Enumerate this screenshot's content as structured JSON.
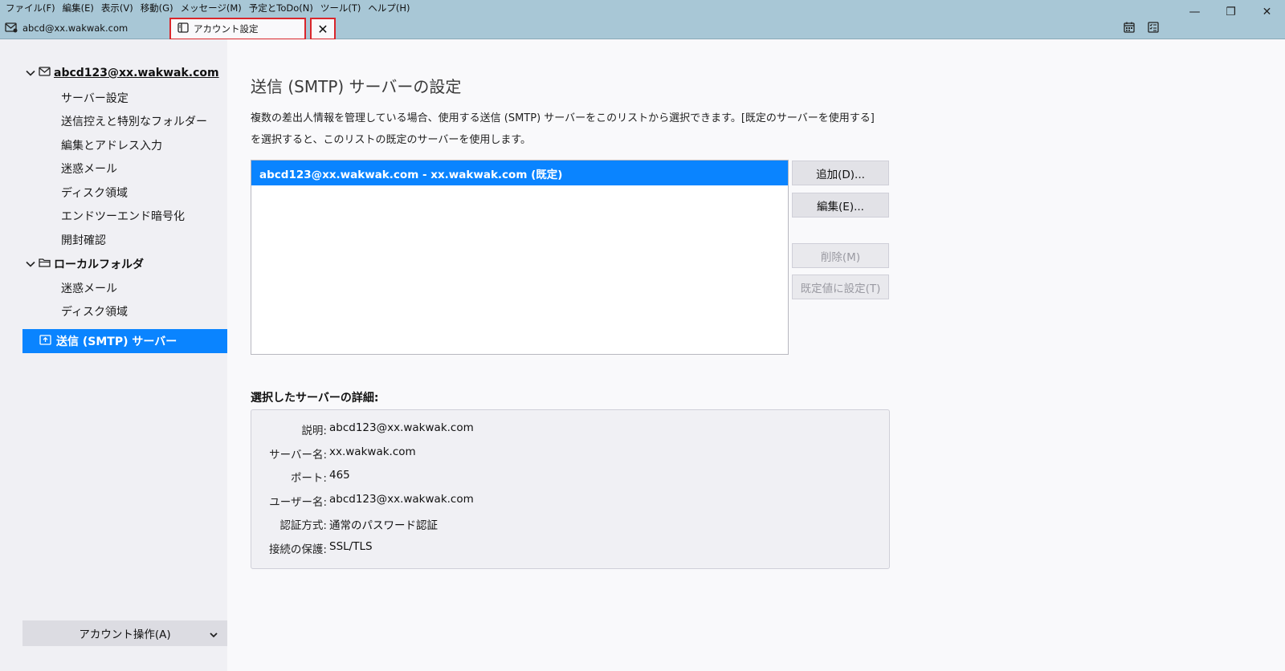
{
  "menu": [
    "ファイル(F)",
    "編集(E)",
    "表示(V)",
    "移動(G)",
    "メッセージ(M)",
    "予定とToDo(N)",
    "ツール(T)",
    "ヘルプ(H)"
  ],
  "window_controls": {
    "minimize": "—",
    "restore": "❐",
    "close": "✕"
  },
  "tabs": {
    "mail": "abcd@xx.wakwak.com",
    "settings": "アカウント設定",
    "close": "✕"
  },
  "sidebar": {
    "account": {
      "name": "abcd123@xx.wakwak.com",
      "items": [
        "サーバー設定",
        "送信控えと特別なフォルダー",
        "編集とアドレス入力",
        "迷惑メール",
        "ディスク領域",
        "エンドツーエンド暗号化",
        "開封確認"
      ]
    },
    "local": {
      "name": "ローカルフォルダ",
      "items": [
        "迷惑メール",
        "ディスク領域"
      ]
    },
    "smtp": "送信 (SMTP) サーバー",
    "account_actions": "アカウント操作(A)"
  },
  "main": {
    "title": "送信 (SMTP) サーバーの設定",
    "description": "複数の差出人情報を管理している場合、使用する送信 (SMTP) サーバーをこのリストから選択できます。[既定のサーバーを使用する] を選択すると、このリストの既定のサーバーを使用します。",
    "servers": [
      "abcd123@xx.wakwak.com - xx.wakwak.com (既定)"
    ],
    "buttons": {
      "add": "追加(D)...",
      "edit": "編集(E)...",
      "delete": "削除(M)",
      "set_default": "既定値に設定(T)"
    },
    "details_title": "選択したサーバーの詳細:",
    "details": [
      {
        "label": "説明:",
        "value": "abcd123@xx.wakwak.com"
      },
      {
        "label": "サーバー名:",
        "value": "xx.wakwak.com"
      },
      {
        "label": "ポート:",
        "value": "465"
      },
      {
        "label": "ユーザー名:",
        "value": "abcd123@xx.wakwak.com"
      },
      {
        "label": "認証方式:",
        "value": "通常のパスワード認証"
      },
      {
        "label": "接続の保護:",
        "value": "SSL/TLS"
      }
    ]
  },
  "colors": {
    "accent": "#0a84ff",
    "titlebar": "#a8c7d6",
    "highlight_border": "#d9262b"
  }
}
